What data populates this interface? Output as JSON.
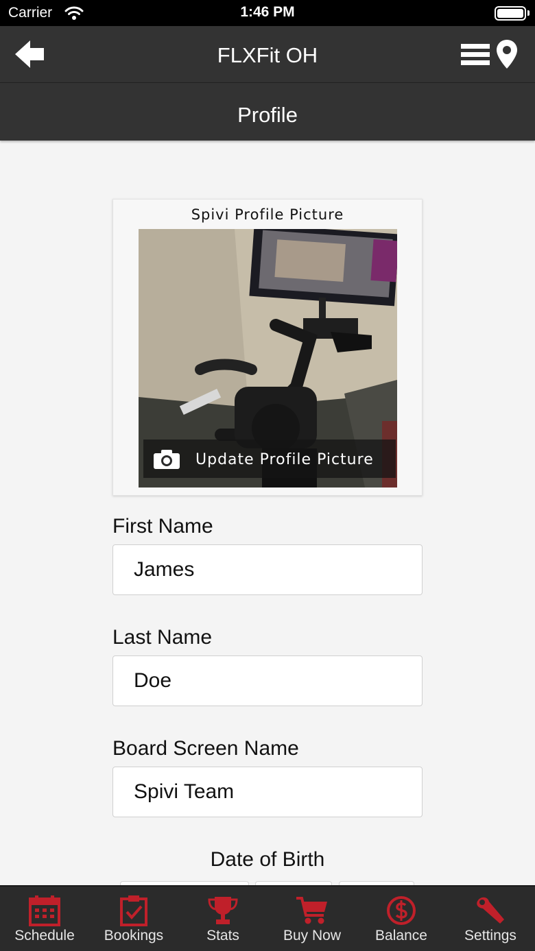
{
  "status": {
    "carrier": "Carrier",
    "time": "1:46 PM"
  },
  "nav": {
    "title": "FLXFit OH"
  },
  "page": {
    "title": "Profile"
  },
  "profile_picture": {
    "title": "Spivi Profile Picture",
    "update_label": "Update Profile Picture"
  },
  "form": {
    "first_name": {
      "label": "First Name",
      "value": "James"
    },
    "last_name": {
      "label": "Last Name",
      "value": "Doe"
    },
    "board_name": {
      "label": "Board Screen Name",
      "value": "Spivi Team"
    },
    "dob": {
      "label": "Date of Birth"
    }
  },
  "tabs": [
    {
      "label": "Schedule",
      "icon": "calendar-icon"
    },
    {
      "label": "Bookings",
      "icon": "clipboard-check-icon"
    },
    {
      "label": "Stats",
      "icon": "trophy-icon"
    },
    {
      "label": "Buy Now",
      "icon": "cart-icon"
    },
    {
      "label": "Balance",
      "icon": "dollar-icon"
    },
    {
      "label": "Settings",
      "icon": "wrench-icon"
    }
  ],
  "colors": {
    "accent": "#c0202a",
    "bar": "#333333",
    "background": "#f4f4f4"
  }
}
